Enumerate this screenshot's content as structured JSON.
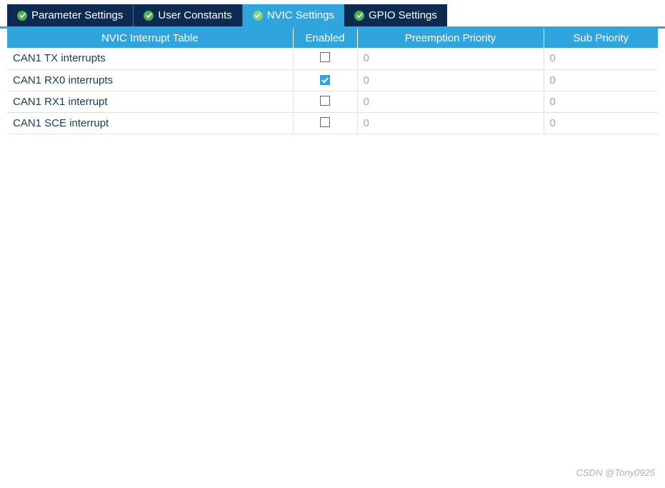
{
  "tabs": [
    {
      "label": "Parameter Settings",
      "active": false
    },
    {
      "label": "User Constants",
      "active": false
    },
    {
      "label": "NVIC Settings",
      "active": true
    },
    {
      "label": "GPIO Settings",
      "active": false
    }
  ],
  "table": {
    "headers": {
      "name": "NVIC Interrupt Table",
      "enabled": "Enabled",
      "preemption": "Preemption Priority",
      "sub": "Sub Priority"
    },
    "rows": [
      {
        "name": "CAN1 TX interrupts",
        "enabled": false,
        "preemption": "0",
        "sub": "0"
      },
      {
        "name": "CAN1 RX0 interrupts",
        "enabled": true,
        "preemption": "0",
        "sub": "0"
      },
      {
        "name": "CAN1 RX1 interrupt",
        "enabled": false,
        "preemption": "0",
        "sub": "0"
      },
      {
        "name": "CAN1 SCE interrupt",
        "enabled": false,
        "preemption": "0",
        "sub": "0"
      }
    ]
  },
  "watermark": "CSDN @Tony0925"
}
